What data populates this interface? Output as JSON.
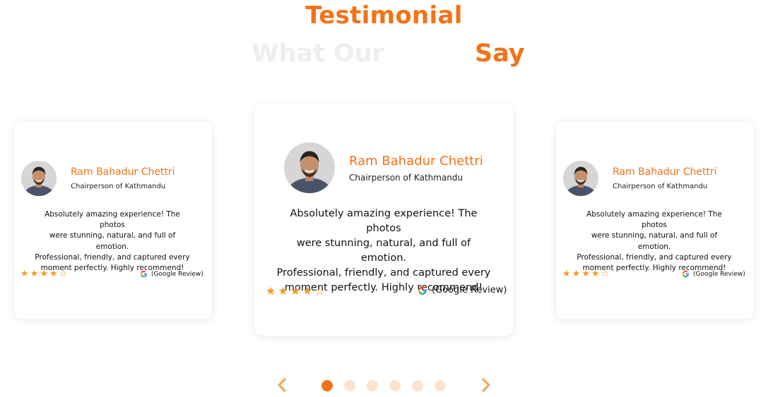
{
  "section": {
    "title": "Testimonial",
    "headline_faded": "What Our",
    "headline_accent": "Say"
  },
  "testimonials": [
    {
      "name": "Ram Bahadur Chettri",
      "role": "Chairperson of Kathmandu",
      "quote_lines": [
        "Absolutely amazing experience! The photos",
        "were stunning, natural, and full of emotion.",
        "Professional, friendly, and captured every",
        "moment perfectly. Highly recommend!"
      ],
      "rating": 4,
      "max_rating": 5,
      "source": "(Google Review)"
    },
    {
      "name": "Ram Bahadur Chettri",
      "role": "Chairperson of Kathmandu",
      "quote_lines": [
        "Absolutely amazing experience! The photos",
        "were stunning, natural, and full of emotion.",
        "Professional, friendly, and captured every",
        "moment perfectly. Highly recommend!"
      ],
      "rating": 4,
      "max_rating": 5,
      "source": "(Google Review)"
    },
    {
      "name": "Ram Bahadur Chettri",
      "role": "Chairperson of Kathmandu",
      "quote_lines": [
        "Absolutely amazing experience! The photos",
        "were stunning, natural, and full of emotion.",
        "Professional, friendly, and captured every",
        "moment perfectly. Highly recommend!"
      ],
      "rating": 4,
      "max_rating": 5,
      "source": "(Google Review)"
    }
  ],
  "pager": {
    "total": 6,
    "active_index": 0,
    "prev_icon": "chevron-left-icon",
    "next_icon": "chevron-right-icon"
  },
  "colors": {
    "accent": "#f47216",
    "faded_heading": "#eeeeee",
    "star": "#f59a23",
    "dot_inactive": "#fde3cf"
  }
}
